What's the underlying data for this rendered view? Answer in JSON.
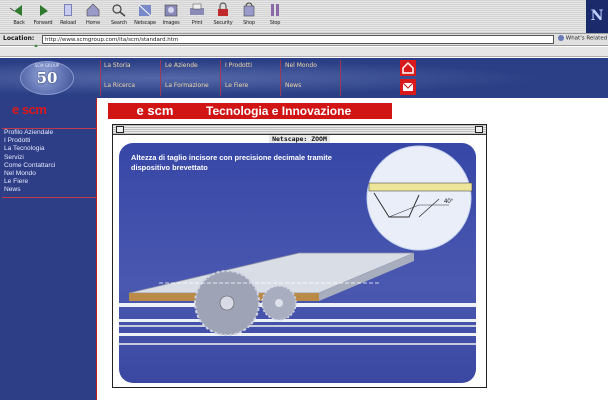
{
  "browser": {
    "toolbar_buttons": [
      {
        "label": "Back",
        "icon": "back-arrow-icon"
      },
      {
        "label": "Forward",
        "icon": "forward-arrow-icon"
      },
      {
        "label": "Reload",
        "icon": "reload-icon"
      },
      {
        "label": "Home",
        "icon": "home-icon"
      },
      {
        "label": "Search",
        "icon": "search-icon"
      },
      {
        "label": "Netscape",
        "icon": "netscape-icon"
      },
      {
        "label": "Images",
        "icon": "images-icon"
      },
      {
        "label": "Print",
        "icon": "print-icon"
      },
      {
        "label": "Security",
        "icon": "security-lock-icon"
      },
      {
        "label": "Shop",
        "icon": "shop-icon"
      },
      {
        "label": "Stop",
        "icon": "stop-icon"
      }
    ],
    "location_label": "Location:",
    "url": "http://www.scmgroup.com/ita/scm/standard.htm",
    "related_label": "What's Related"
  },
  "site": {
    "anniversary": {
      "top": "SCM GROUP",
      "number": "50"
    },
    "nav": [
      {
        "label": "La Storia"
      },
      {
        "label": "Le Aziende"
      },
      {
        "label": "I Prodotti"
      },
      {
        "label": "Nel Mondo"
      },
      {
        "label": "La Ricerca"
      },
      {
        "label": "La Formazione"
      },
      {
        "label": "Le Fiere"
      },
      {
        "label": "News"
      }
    ],
    "logo_left": "scm",
    "menu": [
      "Profilo Aziendale",
      "I Prodotti",
      "La Tecnologia",
      "Servizi",
      "Come Contattarci",
      "Nel Mondo",
      "Le Fiere",
      "News"
    ],
    "banner_logo": "scm",
    "banner_title": "Tecnologia e Innovazione"
  },
  "zoom_window": {
    "title": "Netscape: ZOOM",
    "caption": "Altezza di taglio incisore con precisione decimale tramite dispositivo brevettato",
    "angle_label": "40°"
  },
  "colors": {
    "brand_red": "#d11515",
    "site_blue": "#2b3f86",
    "diagram_blue": "#3f4fa8"
  }
}
